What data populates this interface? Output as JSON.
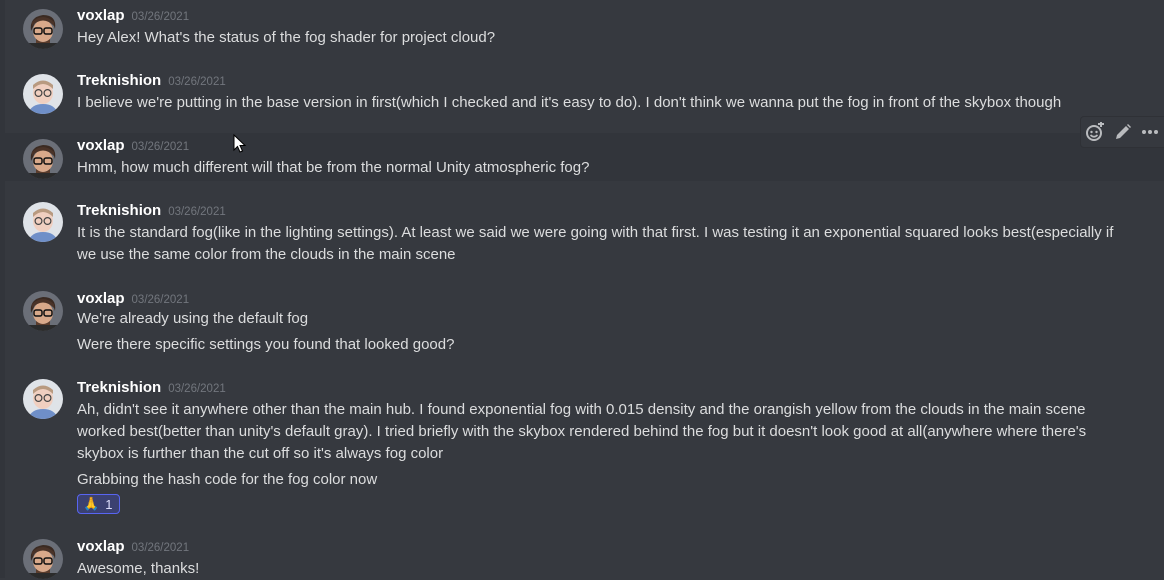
{
  "colors": {
    "background": "#36393f",
    "username": "#ffffff",
    "timestamp": "#72767d",
    "text": "#dcddde",
    "reaction_bg": "#3b4171",
    "reaction_border": "#5865f2"
  },
  "messages": [
    {
      "author": "voxlap",
      "timestamp": "03/26/2021",
      "avatar_icon": "voxlap-avatar",
      "lines": [
        "Hey Alex! What's the status of the fog shader for project cloud?"
      ]
    },
    {
      "author": "Treknishion",
      "timestamp": "03/26/2021",
      "avatar_icon": "treknishion-avatar",
      "lines": [
        "I believe we're putting in the base version in first(which I checked and it's easy to do). I don't think we wanna put the fog in front of the skybox though"
      ]
    },
    {
      "author": "voxlap",
      "timestamp": "03/26/2021",
      "avatar_icon": "voxlap-avatar",
      "lines": [
        "Hmm, how much different will that be from the normal Unity atmospheric fog?"
      ]
    },
    {
      "author": "Treknishion",
      "timestamp": "03/26/2021",
      "avatar_icon": "treknishion-avatar",
      "lines": [
        "It is the standard fog(like in the lighting settings). At least we said we were going with that first. I was testing it an exponential squared looks best(especially if we use the same color from the clouds in the main scene"
      ]
    },
    {
      "author": "voxlap",
      "timestamp": "03/26/2021",
      "avatar_icon": "voxlap-avatar",
      "lines": [
        "We're already using the default fog",
        "Were there specific settings you found that looked good?"
      ]
    },
    {
      "author": "Treknishion",
      "timestamp": "03/26/2021",
      "avatar_icon": "treknishion-avatar",
      "lines": [
        "Ah, didn't see it anywhere other than the main hub. I found exponential fog with 0.015 density and the orangish yellow from the clouds in the main scene worked best(better than unity's default gray). I tried briefly with the skybox rendered behind the fog but it doesn't look good at all(anywhere where there's skybox is further than the cut off so it's always fog color",
        "Grabbing the hash code for the fog color now"
      ],
      "reaction": {
        "emoji": "🙏",
        "count": "1"
      }
    },
    {
      "author": "voxlap",
      "timestamp": "03/26/2021",
      "avatar_icon": "voxlap-avatar",
      "lines": [
        "Awesome, thanks!"
      ]
    }
  ],
  "toolbar": {
    "icons": [
      "add-reaction-icon",
      "edit-icon",
      "more-options-icon"
    ]
  }
}
